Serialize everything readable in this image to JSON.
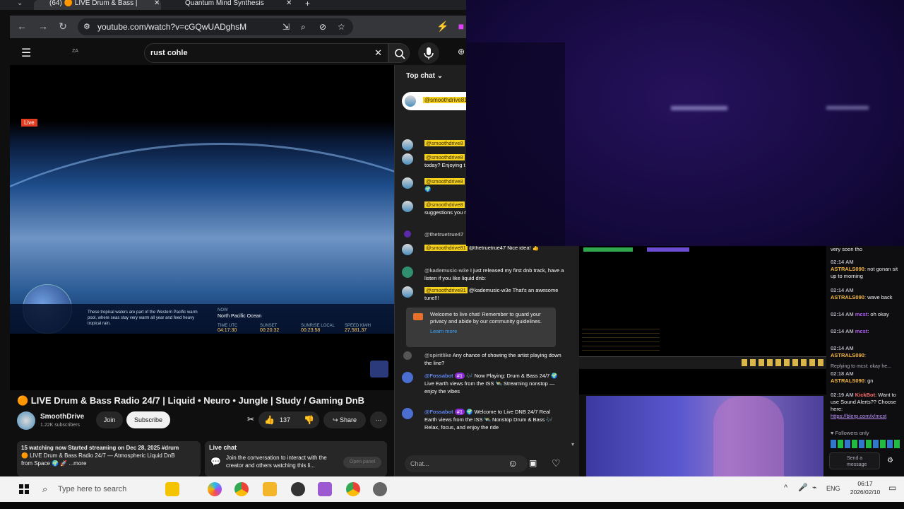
{
  "browser": {
    "tabs": [
      {
        "label": "(64) 🟠 LIVE Drum & Bass |"
      },
      {
        "label": "Quantum Mind Synthesis"
      }
    ],
    "new_tab": "+",
    "url": "youtube.com/watch?v=cGQwUADghsM"
  },
  "youtube": {
    "logo_text": "ZA",
    "search_value": "rust cohle"
  },
  "video": {
    "live_label": "Live",
    "hud_text": "These tropical waters are part of the Western Pacific warm pool, where seas stay very warm all year and feed heavy tropical rain.",
    "hud_region_label": "NOW",
    "hud_region": "North Pacific Ocean",
    "hud_time_label": "TIME UTC",
    "hud_time": "04:17:30",
    "hud_sunset_label": "SUNSET",
    "hud_sunset": "00:20:32",
    "hud_sunrise_label": "SUNRISE LOCAL",
    "hud_sunrise": "00:23:58",
    "hud_speed_label": "SPEED KM/H",
    "hud_speed": "27,581.37",
    "title": "🟠 LIVE Drum & Bass Radio 24/7 | Liquid • Neuro • Jungle | Study / Gaming DnB"
  },
  "channel": {
    "name": "SmoothDrive",
    "subscribers": "1.22K subscribers",
    "join": "Join",
    "subscribe": "Subscribe",
    "likes": "137",
    "share": "Share"
  },
  "description": {
    "line1": "15 watching now  Started streaming on Dec 28, 2025  #drum",
    "line2": "🟠 LIVE Drum & Bass Radio 24/7 — Atmospheric Liquid DnB",
    "line3": "from Space 🌍 🚀   ...more"
  },
  "livechat_box": {
    "title": "Live chat",
    "text": "Join the conversation to interact with the creator and others watching this li...",
    "button": "Open panel"
  },
  "chat": {
    "header": "Top chat",
    "pinned_author": "@smoothdrive81",
    "messages": [
      {
        "author": "@smoothdrive8",
        "text": ""
      },
      {
        "author": "@smoothdrive8",
        "text": "today? Enjoying t"
      },
      {
        "author": "@smoothdrive8",
        "text": "🌍"
      },
      {
        "author": "@smoothdrive8",
        "text": "suggestions you really much appr"
      },
      {
        "author": "@thetruetrue47",
        "text": ""
      },
      {
        "author": "@smoothdrive81",
        "text": "@thetruetrue47 Nice idea! 👍"
      },
      {
        "author": "@kademusic-w3e",
        "text": "I just released my first dnb track, have a listen if you like liquid dnb:"
      },
      {
        "author": "@smoothdrive81",
        "text": "@kademusic-w3e That's an awesome tune!!!"
      }
    ],
    "welcome": "Welcome to live chat! Remember to guard your privacy and abide by our community guidelines.",
    "learn_more": "Learn more",
    "later_messages": [
      {
        "author": "@spiritlike",
        "text": "Any chance of showing the artist playing down the line?"
      },
      {
        "author": "@Fossabot",
        "badge": "#1",
        "text": "🎶 Now Playing: Drum & Bass 24/7 🌍 Live Earth views from the ISS 🛰️ Streaming nonstop — enjoy the vibes"
      },
      {
        "author": "@Fossabot",
        "badge": "#1",
        "text": "🌍 Welcome to Live DNB 24/7 Real Earth views from the ISS 🛰️ Nonstop Drum & Bass 🎶 Relax, focus, and enjoy the ride"
      }
    ],
    "input_placeholder": "Chat..."
  },
  "twitch": {
    "top": "very soon tho",
    "lines": [
      {
        "time": "02:14 AM",
        "name": "ASTRALS090",
        "text": ": not gonan sit up to morning"
      },
      {
        "time": "02:14 AM",
        "name": "ASTRALS090",
        "text": ": wave back"
      },
      {
        "time": "02:14 AM",
        "name": "mcst",
        "text": ": oh okay"
      },
      {
        "time": "02:14 AM",
        "name": "mcst",
        "text": ":"
      },
      {
        "time": "02:14 AM",
        "name": "ASTRALS090",
        "text": ":"
      }
    ],
    "reply": "Replying to mcst: okay he...",
    "reply_time": "02:18 AM",
    "reply_name": "ASTRALS090",
    "reply_text": ": gn",
    "bot_time": "02:19 AM",
    "bot_name": "KickBot",
    "bot_text": ": Want to use Sound Alerts?? Choose here:",
    "bot_link": "https://blerp.com/x/mcst",
    "followers_only": "Followers only",
    "send": "Send a message"
  },
  "taskbar": {
    "search": "Type here to search",
    "lang": "ENG",
    "time": "06:17",
    "date": "2026/02/10"
  },
  "colors": {
    "accent_red": "#e23b1f",
    "chat_highlight": "#f6d21c",
    "twitch_bg": "#0e0e10"
  }
}
